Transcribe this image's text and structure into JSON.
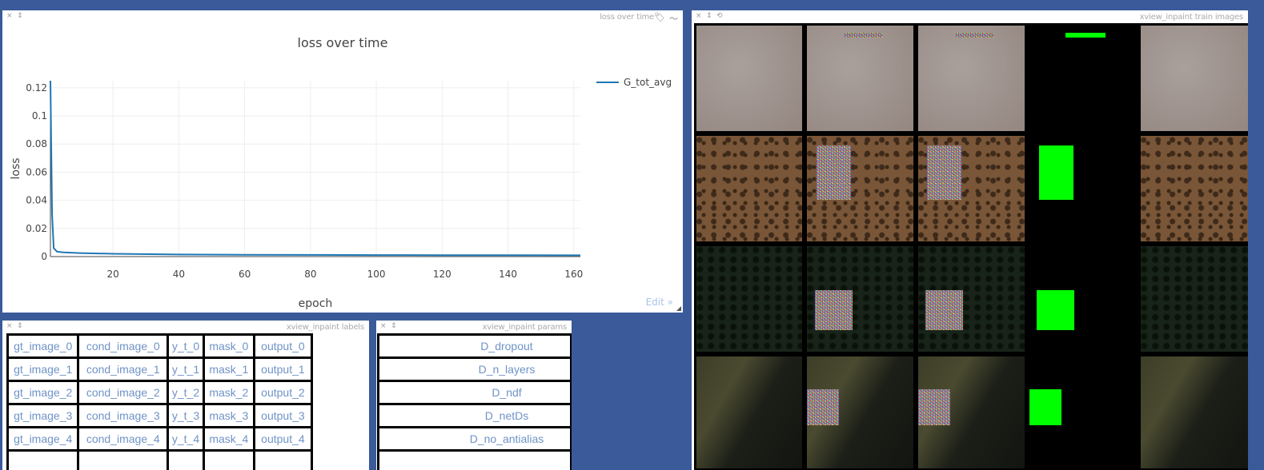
{
  "loss_pane": {
    "controls": {
      "close": "×",
      "pin": "⇕"
    },
    "window_title": "loss over time",
    "edit_label": "Edit »"
  },
  "chart_data": {
    "type": "line",
    "title": "loss over time",
    "xlabel": "epoch",
    "ylabel": "loss",
    "xlim": [
      1,
      162
    ],
    "ylim": [
      0,
      0.125
    ],
    "xticks": [
      20,
      40,
      60,
      80,
      100,
      120,
      140,
      160
    ],
    "yticks": [
      0,
      0.02,
      0.04,
      0.06,
      0.08,
      0.1,
      0.12
    ],
    "ytick_labels": [
      "0",
      "0.02",
      "0.04",
      "0.06",
      "0.08",
      "0.1",
      "0.12"
    ],
    "grid": true,
    "legend_position": "top-right",
    "series": [
      {
        "name": "G_tot_avg",
        "color": "#1f77b4",
        "x": [
          1,
          1.5,
          2,
          3,
          5,
          10,
          20,
          40,
          60,
          80,
          100,
          120,
          140,
          162
        ],
        "values": [
          0.125,
          0.03,
          0.006,
          0.0035,
          0.003,
          0.0025,
          0.002,
          0.0015,
          0.0013,
          0.0012,
          0.0011,
          0.001,
          0.001,
          0.0009
        ]
      }
    ]
  },
  "images_pane": {
    "controls": {
      "close": "×",
      "pin": "⇕",
      "reset": "⟲"
    },
    "window_title": "xview_inpaint train images"
  },
  "labels_pane": {
    "controls": {
      "close": "×",
      "pin": "⇕"
    },
    "window_title": "xview_inpaint labels",
    "rows": [
      [
        "gt_image_0",
        "cond_image_0",
        "y_t_0",
        "mask_0",
        "output_0"
      ],
      [
        "gt_image_1",
        "cond_image_1",
        "y_t_1",
        "mask_1",
        "output_1"
      ],
      [
        "gt_image_2",
        "cond_image_2",
        "y_t_2",
        "mask_2",
        "output_2"
      ],
      [
        "gt_image_3",
        "cond_image_3",
        "y_t_3",
        "mask_3",
        "output_3"
      ],
      [
        "gt_image_4",
        "cond_image_4",
        "y_t_4",
        "mask_4",
        "output_4"
      ]
    ]
  },
  "params_pane": {
    "controls": {
      "close": "×",
      "pin": "⇕"
    },
    "window_title": "xview_inpaint params",
    "rows": [
      "D_dropout",
      "D_n_layers",
      "D_ndf",
      "D_netDs",
      "D_no_antialias"
    ]
  }
}
